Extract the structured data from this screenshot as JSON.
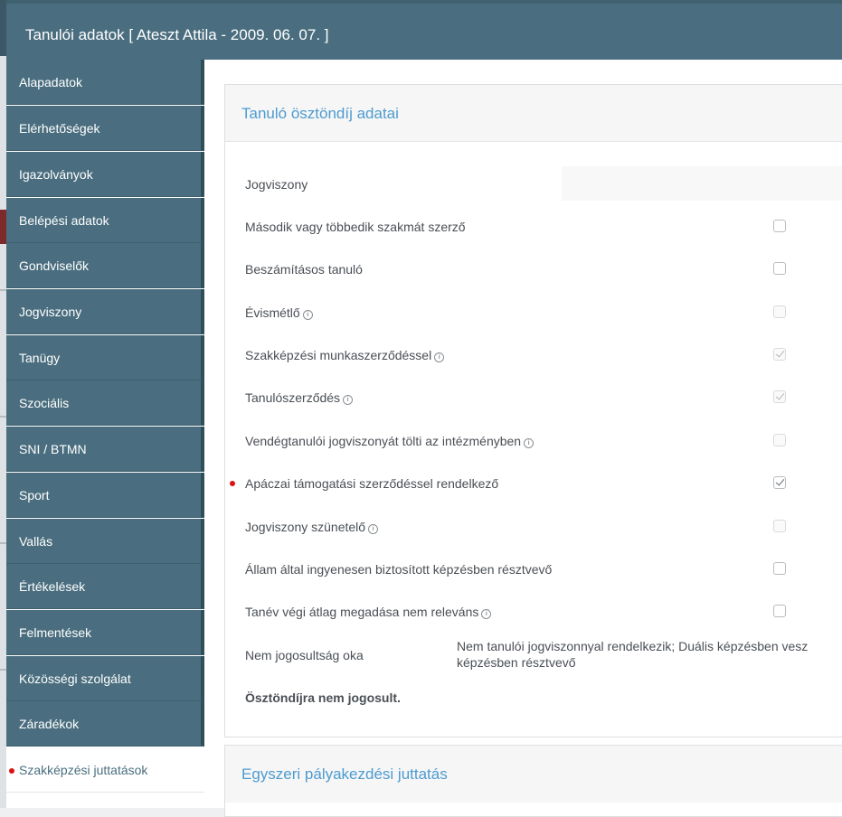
{
  "modal": {
    "title": "Tanulói adatok [ Ateszt Attila - 2009. 06. 07. ]"
  },
  "sidebar": {
    "items": [
      {
        "label": "Alapadatok"
      },
      {
        "label": "Elérhetőségek"
      },
      {
        "label": "Igazolványok"
      },
      {
        "label": "Belépési adatok"
      },
      {
        "label": "Gondviselők"
      },
      {
        "label": "Jogviszony"
      },
      {
        "label": "Tanügy"
      },
      {
        "label": "Szociális"
      },
      {
        "label": "SNI / BTMN"
      },
      {
        "label": "Sport"
      },
      {
        "label": "Vallás"
      },
      {
        "label": "Értékelések"
      },
      {
        "label": "Felmentések"
      },
      {
        "label": "Közösségi szolgálat"
      },
      {
        "label": "Záradékok"
      },
      {
        "label": "Szakképzési juttatások",
        "active": true
      }
    ]
  },
  "panel1": {
    "title": "Tanuló ösztöndíj adatai",
    "jogviszony_label": "Jogviszony",
    "jogviszony_value": "",
    "rows": [
      {
        "label": "Második vagy többedik szakmát szerző",
        "checked": false,
        "disabled": false
      },
      {
        "label": "Beszámításos tanuló",
        "checked": false,
        "disabled": false
      },
      {
        "label": "Évismétlő",
        "checked": false,
        "disabled": true
      },
      {
        "label": "Szakképzési munkaszerződéssel",
        "checked": true,
        "disabled": true
      },
      {
        "label": "Tanulószerződés",
        "checked": true,
        "disabled": true
      },
      {
        "label": "Vendégtanulói jogviszonyát tölti az intézményben",
        "checked": false,
        "disabled": true
      },
      {
        "label": "Apáczai támogatási szerződéssel rendelkező",
        "checked": true,
        "disabled": false
      },
      {
        "label": "Jogviszony szünetelő",
        "checked": false,
        "disabled": true
      },
      {
        "label": "Állam által ingyenesen biztosított képzésben résztvevő",
        "checked": false,
        "disabled": false
      },
      {
        "label": "Tanév végi átlag megadása nem releváns",
        "checked": false,
        "disabled": false
      }
    ],
    "reason_label": "Nem jogosultság oka",
    "reason_value_line1": "Nem tanulói jogviszonnyal rendelkezik; Duális képzésben vesz",
    "reason_value_line2": "képzésben résztvevő",
    "status": "Ösztöndíjra nem jogosult."
  },
  "panel2": {
    "title": "Egyszeri pályakezdési juttatás"
  },
  "colors": {
    "header_bg": "#4a6e7f",
    "panel_title": "#4e9bcf",
    "required_dot": "#dd1111"
  }
}
